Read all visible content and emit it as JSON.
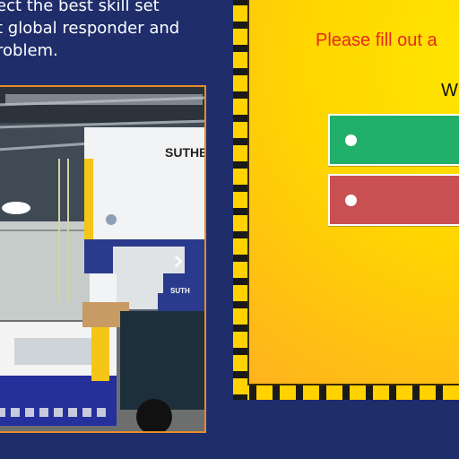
{
  "intro": {
    "lines": [
      "ect the best skill set",
      "t global responder and",
      "roblem."
    ]
  },
  "photo": {
    "alt_icon": "industrial-press-photo",
    "machine_label": "SUTHE",
    "machine_label_small": "SUTH",
    "next_icon": "chevron-right-icon"
  },
  "form": {
    "prompt": "Please fill out a",
    "question_fragment": "W",
    "options": [
      {
        "color": "#20b06a"
      },
      {
        "color": "#c84f52"
      }
    ]
  },
  "colors": {
    "background": "#1f2d6b",
    "panel_yellow": "#ffd600",
    "hazard_black": "#1a1a1a",
    "prompt_red": "#e8281e",
    "photo_border": "#e98a2a"
  }
}
